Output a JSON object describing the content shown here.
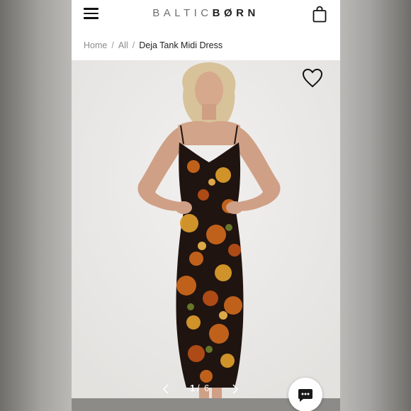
{
  "header": {
    "logo_part1": "BALTIC",
    "logo_part2": "BØRN",
    "menu_icon": "hamburger-menu-icon",
    "cart_icon": "shopping-bag-icon"
  },
  "breadcrumb": {
    "items": [
      "Home",
      "All"
    ],
    "current": "Deja Tank Midi Dress"
  },
  "product_image": {
    "wishlist_icon": "heart-outline-icon",
    "current_slide": "1",
    "total_slides": "6"
  },
  "chat": {
    "icon": "chat-bubble-icon"
  },
  "colors": {
    "dress_dark": "#1f1410",
    "dress_orange": "#c9661c",
    "dress_gold": "#d99a2b",
    "header_bg": "#ffffff",
    "photo_bg": "#efeeed"
  }
}
